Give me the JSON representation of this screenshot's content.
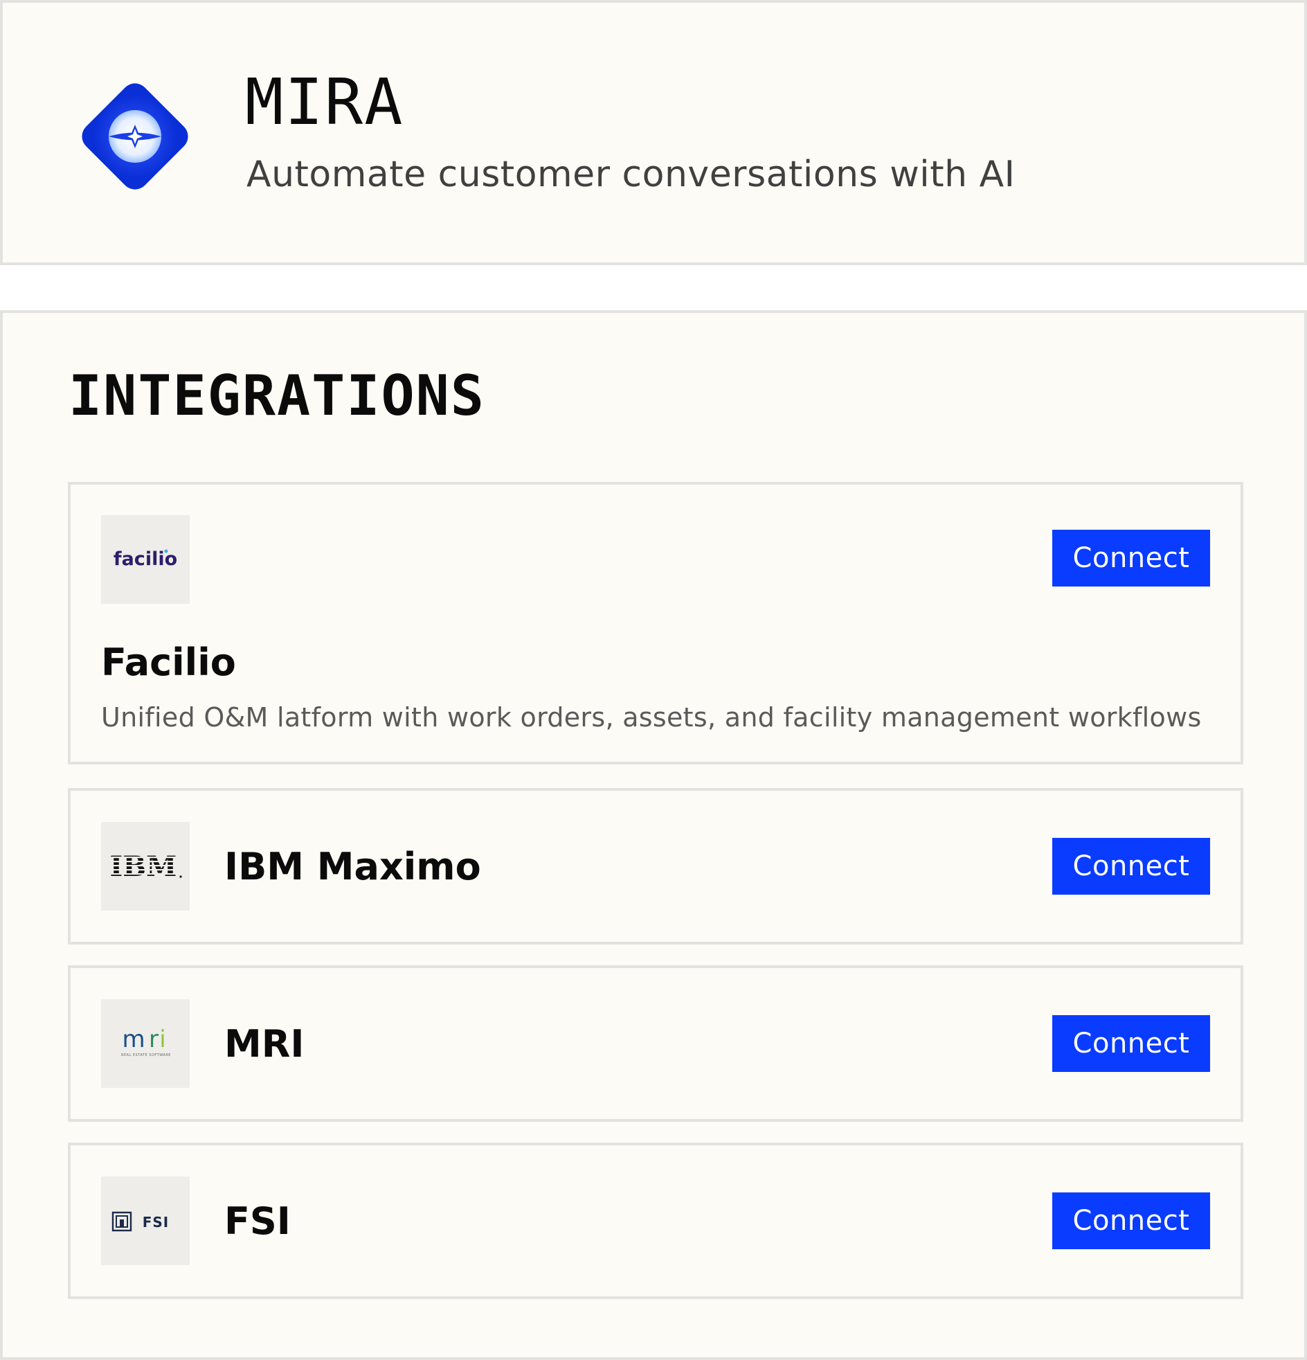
{
  "app": {
    "title": "MIRA",
    "subtitle": "Automate customer conversations with AI",
    "logo_icon": "mira-logo-icon",
    "brand_color": "#0a3cff"
  },
  "integrations": {
    "heading": "INTEGRATIONS",
    "items": [
      {
        "name": "Facilio",
        "logo_icon": "facilio-logo",
        "logo_text": "facilio",
        "description": "Unified O&M latform with work orders, assets, and facility management workflows",
        "action_label": "Connect"
      },
      {
        "name": "IBM Maximo",
        "logo_icon": "ibm-logo",
        "logo_text": "IBM",
        "action_label": "Connect"
      },
      {
        "name": "MRI",
        "logo_icon": "mri-logo",
        "logo_text": "mri",
        "logo_subtext": "REAL ESTATE SOFTWARE",
        "action_label": "Connect"
      },
      {
        "name": "FSI",
        "logo_icon": "fsi-logo",
        "logo_text": "FSI",
        "action_label": "Connect"
      }
    ]
  }
}
